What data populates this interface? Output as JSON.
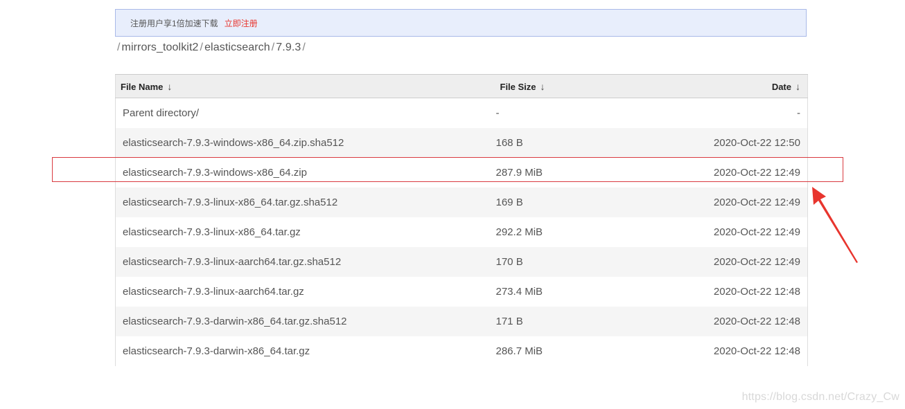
{
  "banner": {
    "text": "注册用户享1倍加速下载",
    "link": "立即注册",
    "link_color": "#e8352e"
  },
  "breadcrumb": {
    "segments": [
      "mirrors_toolkit2",
      "elasticsearch",
      "7.9.3"
    ],
    "separator": "/"
  },
  "table": {
    "headers": {
      "name": "File Name",
      "size": "File Size",
      "date": "Date",
      "sort_arrow": "↓"
    },
    "rows": [
      {
        "name": "Parent directory/",
        "size": "-",
        "date": "-"
      },
      {
        "name": "elasticsearch-7.9.3-windows-x86_64.zip.sha512",
        "size": "168 B",
        "date": "2020-Oct-22 12:50"
      },
      {
        "name": "elasticsearch-7.9.3-windows-x86_64.zip",
        "size": "287.9 MiB",
        "date": "2020-Oct-22 12:49"
      },
      {
        "name": "elasticsearch-7.9.3-linux-x86_64.tar.gz.sha512",
        "size": "169 B",
        "date": "2020-Oct-22 12:49"
      },
      {
        "name": "elasticsearch-7.9.3-linux-x86_64.tar.gz",
        "size": "292.2 MiB",
        "date": "2020-Oct-22 12:49"
      },
      {
        "name": "elasticsearch-7.9.3-linux-aarch64.tar.gz.sha512",
        "size": "170 B",
        "date": "2020-Oct-22 12:49"
      },
      {
        "name": "elasticsearch-7.9.3-linux-aarch64.tar.gz",
        "size": "273.4 MiB",
        "date": "2020-Oct-22 12:48"
      },
      {
        "name": "elasticsearch-7.9.3-darwin-x86_64.tar.gz.sha512",
        "size": "171 B",
        "date": "2020-Oct-22 12:48"
      },
      {
        "name": "elasticsearch-7.9.3-darwin-x86_64.tar.gz",
        "size": "286.7 MiB",
        "date": "2020-Oct-22 12:48"
      }
    ]
  },
  "annotation": {
    "color": "#e8352e",
    "arrow_icon": "red-arrow-icon"
  },
  "watermark": "https://blog.csdn.net/Crazy_Cw"
}
